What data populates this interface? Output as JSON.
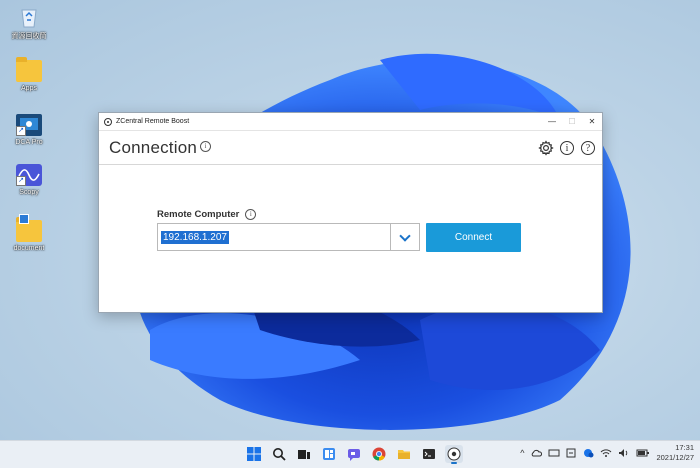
{
  "desktop": {
    "icons": [
      {
        "label": "資源回收筒",
        "icon": "recycle-bin-icon"
      },
      {
        "label": "Apps",
        "icon": "folder-icon"
      },
      {
        "label": "DCA Pro",
        "icon": "app-shortcut-icon"
      },
      {
        "label": "Scopy",
        "icon": "app-shortcut-icon"
      },
      {
        "label": "document",
        "icon": "folder-icon"
      }
    ]
  },
  "window": {
    "title": "ZCentral Remote Boost",
    "controls": {
      "minimize": "—",
      "maximize": "☐",
      "close": "✕"
    },
    "header": {
      "title": "Connection",
      "info_glyph": "i",
      "settings_glyph": "⚙",
      "about_glyph": "i",
      "help_glyph": "?"
    },
    "form": {
      "label": "Remote Computer",
      "info_glyph": "i",
      "value": "192.168.1.207",
      "connect_label": "Connect"
    }
  },
  "taskbar": {
    "items": [
      {
        "icon": "start-icon"
      },
      {
        "icon": "search-icon"
      },
      {
        "icon": "task-view-icon"
      },
      {
        "icon": "widgets-icon"
      },
      {
        "icon": "chat-icon"
      },
      {
        "icon": "chrome-icon"
      },
      {
        "icon": "file-explorer-icon"
      },
      {
        "icon": "terminal-icon"
      },
      {
        "icon": "zcentral-icon",
        "active": true
      }
    ],
    "tray": {
      "chevron": "^",
      "time": "17:31",
      "date": "2021/12/27"
    }
  },
  "colors": {
    "accent": "#1a9ad9",
    "selection": "#1f6fd1",
    "chevron": "#1a73c9"
  }
}
